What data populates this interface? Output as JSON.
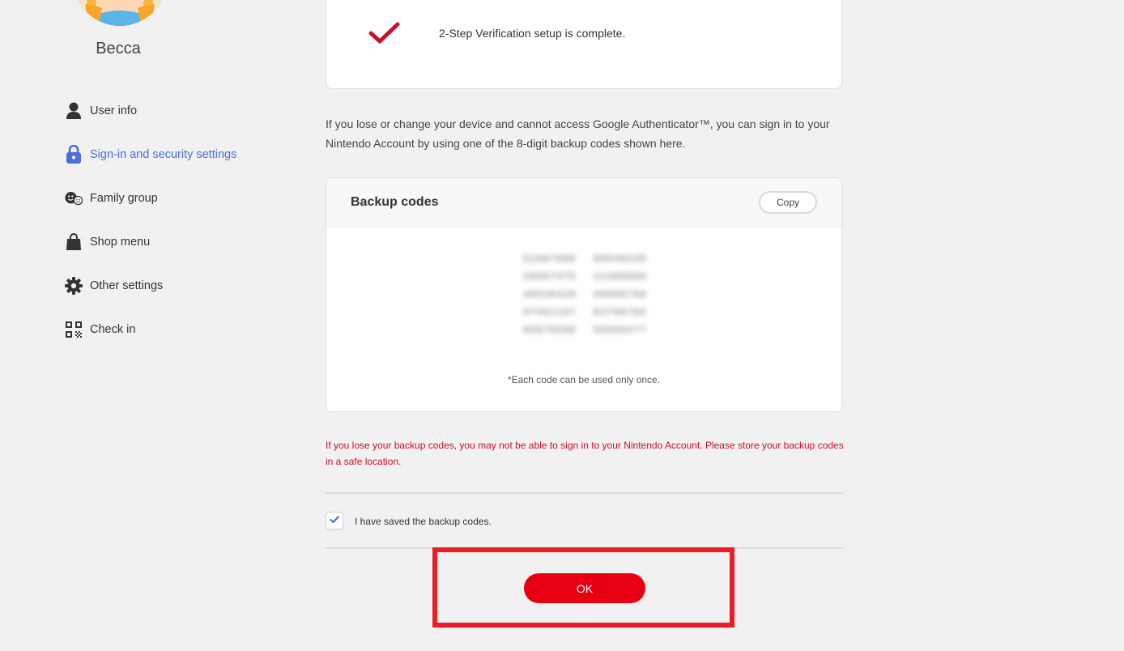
{
  "sidebar": {
    "username": "Becca",
    "items": [
      {
        "label": "User info",
        "icon": "person-icon"
      },
      {
        "label": "Sign-in and security settings",
        "icon": "lock-icon",
        "active": true
      },
      {
        "label": "Family group",
        "icon": "family-icon"
      },
      {
        "label": "Shop menu",
        "icon": "shopping-bag-icon"
      },
      {
        "label": "Other settings",
        "icon": "gear-icon"
      },
      {
        "label": "Check in",
        "icon": "qr-code-icon"
      }
    ]
  },
  "main": {
    "complete_message": "2-Step Verification setup is complete.",
    "info_text": "If you lose or change your device and cannot access Google Authenticator™, you can sign in to your Nintendo Account by using one of the 8-digit backup codes shown here.",
    "backup": {
      "title": "Backup codes",
      "copy_label": "Copy",
      "codes": [
        "51687686",
        "06940235",
        "26507475",
        "21308860",
        "46536420",
        "99900760",
        "97461107",
        "62708783",
        "60676580",
        "50906477"
      ],
      "note": "*Each code can be used only once."
    },
    "warning_text": "If you lose your backup codes, you may not be able to sign in to your Nintendo Account. Please store your backup codes in a safe location.",
    "confirm_label": "I have saved the backup codes.",
    "confirm_checked": true,
    "ok_label": "OK"
  },
  "colors": {
    "accent": "#4b6fd6",
    "brand_red": "#e60012",
    "warning_red": "#c8102e",
    "highlight": "#ec1c24"
  }
}
